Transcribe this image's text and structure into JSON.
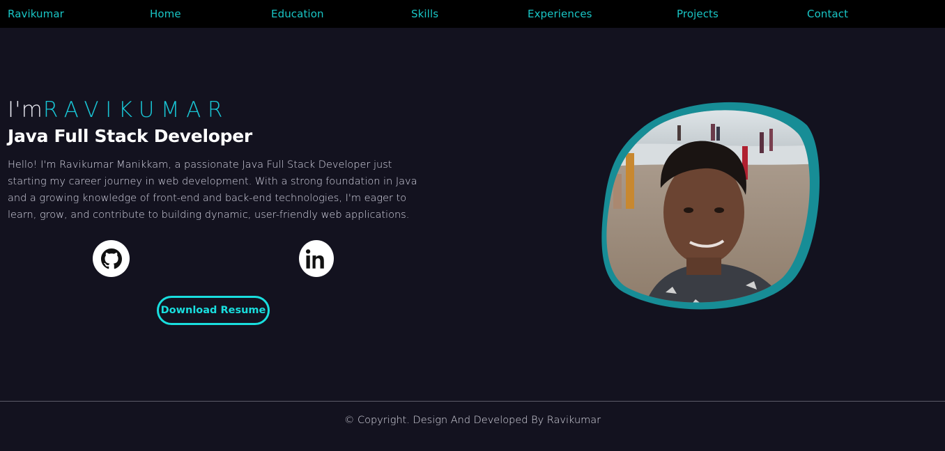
{
  "nav": {
    "brand": "Ravikumar",
    "items": [
      {
        "label": "Home"
      },
      {
        "label": "Education"
      },
      {
        "label": "Skills"
      },
      {
        "label": "Experiences"
      },
      {
        "label": "Projects"
      },
      {
        "label": "Contact"
      }
    ]
  },
  "hero": {
    "greeting": "I'm",
    "name": "RAVIKUMAR",
    "role": "Java Full Stack Developer",
    "bio": "Hello! I'm Ravikumar Manikkam, a passionate Java Full Stack Developer just starting my career journey in web development. With a strong foundation in Java and a growing knowledge of front-end and back-end technologies, I'm eager to learn, grow, and contribute to building dynamic, user-friendly web applications.",
    "social": [
      {
        "icon": "github-icon"
      },
      {
        "icon": "linkedin-icon"
      }
    ],
    "download_label": "Download Resume"
  },
  "footer": {
    "text": "© Copyright. Design And Developed By Ravikumar"
  },
  "colors": {
    "background": "#13121f",
    "navbar": "#000000",
    "accent": "#19c6c6",
    "blob": "#178d96"
  }
}
